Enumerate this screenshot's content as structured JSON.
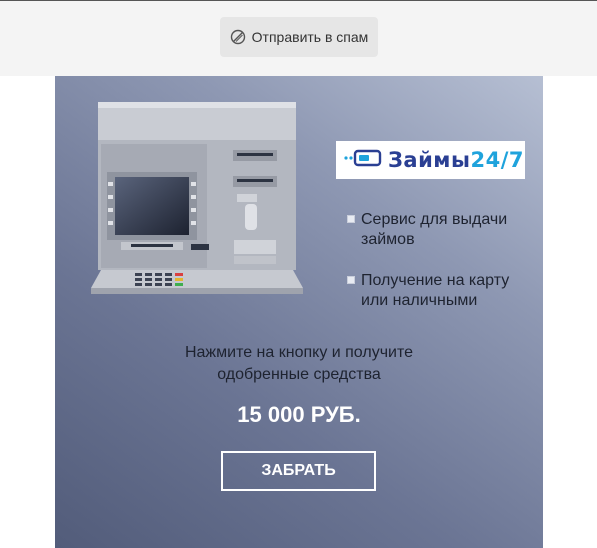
{
  "toolbar": {
    "spam_label": "Отправить в спам",
    "spam_icon": "block-icon"
  },
  "banner": {
    "logo": {
      "main": "Займы",
      "accent": "24/7",
      "main_color": "#2a3f93",
      "accent_color": "#1fa3dc"
    },
    "features": [
      {
        "line1": "Сервис для выдачи",
        "line2": "займов"
      },
      {
        "line1": "Получение на карту",
        "line2": "или наличными"
      }
    ],
    "cta": {
      "line1": "Нажмите на кнопку и получите",
      "line2": "одобренные средства"
    },
    "amount": "15 000 РУБ.",
    "button_label": "ЗАБРАТЬ",
    "colors": {
      "gradient_dark": "#525c7a",
      "gradient_light": "#b6bfd3"
    }
  }
}
